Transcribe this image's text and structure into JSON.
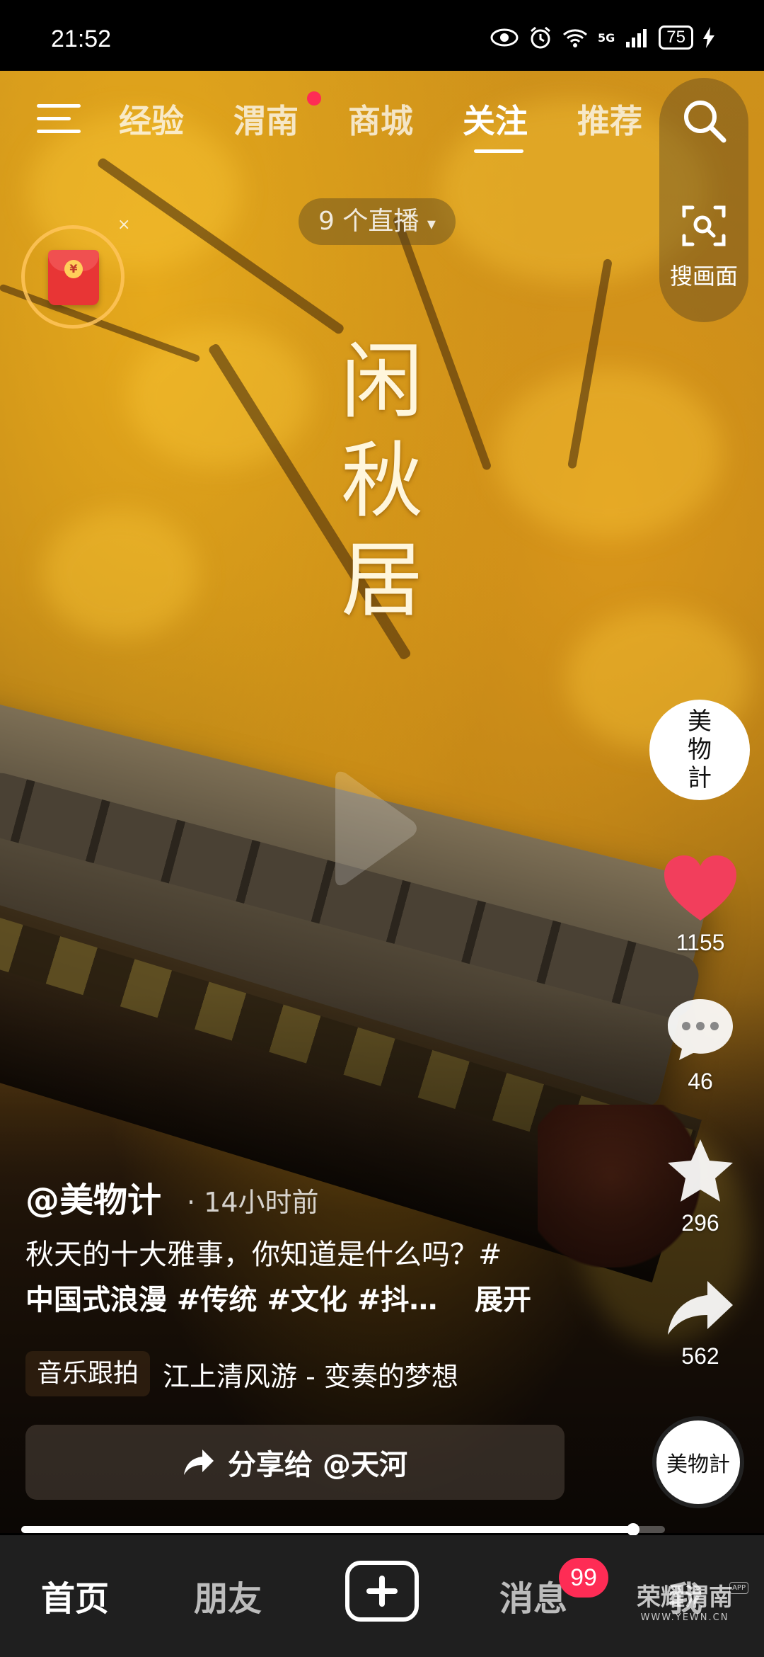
{
  "status_bar": {
    "time": "21:52",
    "network": "5G",
    "battery": "75"
  },
  "top_nav": {
    "tabs": [
      {
        "label": "经验"
      },
      {
        "label": "渭南"
      },
      {
        "label": "商城"
      },
      {
        "label": "关注"
      },
      {
        "label": "推荐"
      }
    ],
    "active_tab": "关注",
    "scan_label": "搜画面"
  },
  "live": {
    "label": "9 个直播",
    "caret": "▾"
  },
  "red_envelope": {
    "symbol": "¥",
    "close": "×"
  },
  "video": {
    "overlay_title": [
      "闲",
      "秋",
      "居"
    ]
  },
  "actions": {
    "avatar_text": "美物計",
    "likes": "1155",
    "comments": "46",
    "favorites": "296",
    "shares": "562",
    "music_disc_text": "美物計"
  },
  "post": {
    "author": "@美物计",
    "time_ago": "· 14小时前",
    "caption_text": "秋天的十大雅事，你知道是什么吗？#",
    "caption_tags": "中国式浪漫 #传统 #文化 #抖…",
    "expand_label": "展开",
    "music_chip": "音乐跟拍",
    "music_title": "江上清风游 - 变奏的梦想",
    "share_label": "分享给 @天河"
  },
  "progress": 0.95,
  "tab_bar": {
    "tabs": [
      "首页",
      "朋友",
      "消息",
      "我"
    ],
    "active": "首页",
    "messages_badge": "99"
  },
  "watermark": {
    "name": "荣耀渭南",
    "url": "WWW.YEWN.CN",
    "app": "APP"
  },
  "colors": {
    "accent_red": "#fe2c55",
    "like_red": "#f23e5c",
    "tab_bar_bg": "#1f1f1f"
  }
}
